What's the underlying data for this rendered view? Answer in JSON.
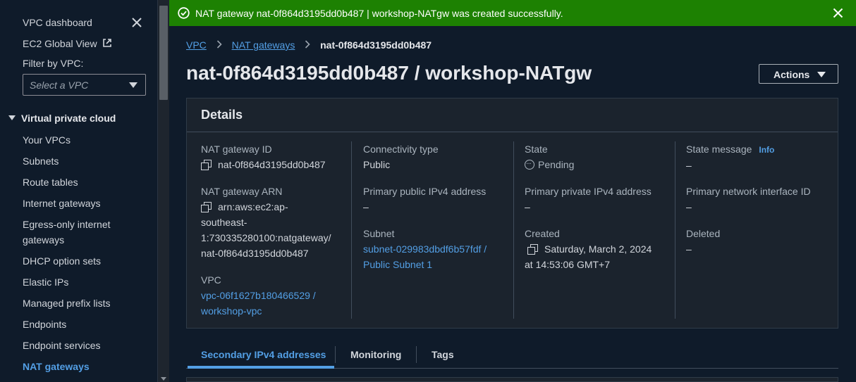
{
  "flash": {
    "message": "NAT gateway nat-0f864d3195dd0b487 | workshop-NATgw was created successfully.",
    "color": "#1d8102"
  },
  "sidebar": {
    "top_links": [
      {
        "label": "VPC dashboard"
      },
      {
        "label": "EC2 Global View",
        "external": true
      }
    ],
    "filter_label": "Filter by VPC:",
    "filter_placeholder": "Select a VPC",
    "section_title": "Virtual private cloud",
    "items": [
      {
        "label": "Your VPCs"
      },
      {
        "label": "Subnets"
      },
      {
        "label": "Route tables"
      },
      {
        "label": "Internet gateways"
      },
      {
        "label": "Egress-only internet gateways",
        "line1": "Egress-only internet",
        "line2": "gateways"
      },
      {
        "label": "DHCP option sets"
      },
      {
        "label": "Elastic IPs"
      },
      {
        "label": "Managed prefix lists"
      },
      {
        "label": "Endpoints"
      },
      {
        "label": "Endpoint services"
      },
      {
        "label": "NAT gateways",
        "active": true
      }
    ]
  },
  "breadcrumb": {
    "items": [
      "VPC",
      "NAT gateways"
    ],
    "current": "nat-0f864d3195dd0b487"
  },
  "page_title": "nat-0f864d3195dd0b487 / workshop-NATgw",
  "actions_label": "Actions",
  "details": {
    "title": "Details",
    "nat_gateway_id": {
      "label": "NAT gateway ID",
      "value": "nat-0f864d3195dd0b487"
    },
    "nat_gateway_arn": {
      "label": "NAT gateway ARN",
      "line1": "arn:aws:ec2:ap-",
      "line2": "southeast-",
      "line3": "1:730335280100:natgateway/",
      "line4": "nat-0f864d3195dd0b487"
    },
    "vpc": {
      "label": "VPC",
      "line1": "vpc-06f1627b180466529 /",
      "line2": "workshop-vpc"
    },
    "connectivity_type": {
      "label": "Connectivity type",
      "value": "Public"
    },
    "primary_public_ipv4": {
      "label": "Primary public IPv4 address",
      "value": "–"
    },
    "subnet": {
      "label": "Subnet",
      "line1": "subnet-029983dbdf6b57fdf /",
      "line2": "Public Subnet 1"
    },
    "state": {
      "label": "State",
      "value": "Pending"
    },
    "primary_private_ipv4": {
      "label": "Primary private IPv4 address",
      "value": "–"
    },
    "created": {
      "label": "Created",
      "line1": "Saturday, March 2, 2024",
      "line2": "at 14:53:06 GMT+7"
    },
    "state_message": {
      "label": "State message",
      "info": "Info",
      "value": "–"
    },
    "primary_network_interface": {
      "label": "Primary network interface ID",
      "value": "–"
    },
    "deleted": {
      "label": "Deleted",
      "value": "–"
    }
  },
  "tabs": [
    {
      "label": "Secondary IPv4 addresses",
      "active": true
    },
    {
      "label": "Monitoring"
    },
    {
      "label": "Tags"
    }
  ],
  "colors": {
    "link": "#539fe5",
    "background": "#0f1b2a",
    "panel": "#1b232d"
  }
}
